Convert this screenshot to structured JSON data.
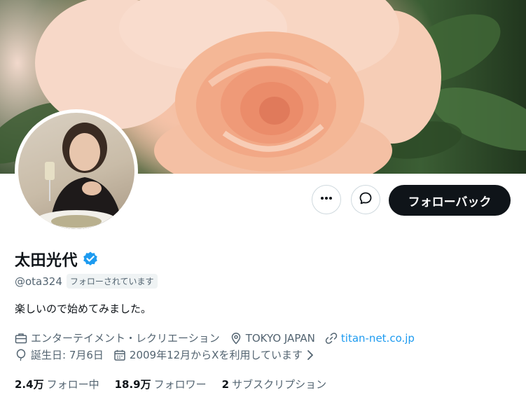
{
  "profile": {
    "display_name": "太田光代",
    "handle": "@ota324",
    "follows_you_badge": "フォローされています",
    "bio": "楽しいので始めてみました。",
    "category": "エンターテイメント・レクリエーション",
    "location": "TOKYO JAPAN",
    "website": "titan-net.co.jp",
    "birthday": "誕生日: 7月6日",
    "joined": "2009年12月からXを利用しています"
  },
  "actions": {
    "follow_back_label": "フォローバック"
  },
  "stats": {
    "following_count": "2.4万",
    "following_label": "フォロー中",
    "followers_count": "18.9万",
    "followers_label": "フォロワー",
    "subscriptions_count": "2",
    "subscriptions_label": "サブスクリプション"
  },
  "colors": {
    "accent": "#1d9bf0",
    "primary_button": "#0f1419",
    "muted_text": "#536471"
  },
  "icons": [
    "more-icon",
    "message-icon",
    "verified-icon",
    "briefcase-icon",
    "location-icon",
    "link-icon",
    "balloon-icon",
    "calendar-icon",
    "chevron-right-icon"
  ]
}
